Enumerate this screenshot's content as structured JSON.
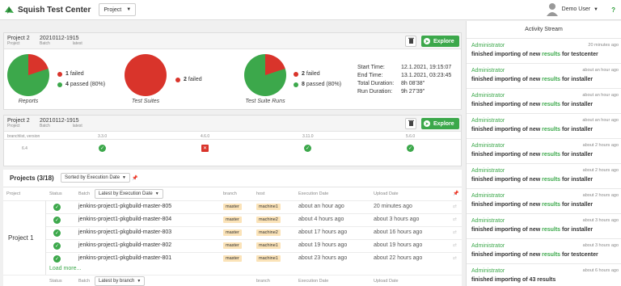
{
  "app": {
    "title": "Squish Test Center",
    "help": "?"
  },
  "header": {
    "project_select": "Project",
    "user_name": "Demo User"
  },
  "colors": {
    "pass": "#3ca84b",
    "fail": "#d9342b",
    "accent": "#3ca84b",
    "tag": "#fbe3b8"
  },
  "summary": {
    "project": "Project 2",
    "project_label": "Project",
    "batch": "20210112-1915",
    "batch_label": "Batch",
    "latest_label": "latest",
    "explore": "Explore",
    "charts": [
      {
        "caption": "Reports",
        "failed": "1",
        "failed_label": "failed",
        "passed": "4",
        "passed_label": "passed (80%)",
        "fail_fraction": 0.2
      },
      {
        "caption": "Test Suites",
        "failed": "2",
        "failed_label": "failed",
        "fail_fraction": 1.0
      },
      {
        "caption": "Test Suite Runs",
        "failed": "2",
        "failed_label": "failed",
        "passed": "8",
        "passed_label": "passed (80%)",
        "fail_fraction": 0.2
      }
    ],
    "times": {
      "start_label": "Start Time:",
      "start": "12.1.2021, 19:15:07",
      "end_label": "End Time:",
      "end": "13.1.2021, 03:23:45",
      "total_label": "Total Duration:",
      "total": "8h 08'38\"",
      "run_label": "Run Duration:",
      "run": "9h 27'39\""
    }
  },
  "matrix": {
    "project": "Project 2",
    "project_label": "Project",
    "batch": "20210112-1915",
    "batch_label": "Batch",
    "latest_label": "latest",
    "explore": "Explore",
    "corner": "branchlist, version",
    "columns": [
      "3.3.0",
      "4.6.0",
      "3.11.0",
      "5.6.0"
    ],
    "row_label": "6.4",
    "statuses": [
      "pass",
      "fail",
      "pass",
      "pass"
    ]
  },
  "projects": {
    "title": "Projects (3/18)",
    "sort": "Sorted by Execution Date",
    "headers": {
      "project": "Project",
      "status": "Status",
      "batch": "Batch",
      "batch_sort": "Latest by Execution Date",
      "branch": "branch",
      "host": "host",
      "exec": "Execution Date",
      "upload": "Upload Date"
    },
    "group": "Project 1",
    "rows": [
      {
        "batch": "jenkins-project1-pkgbuild-master-805",
        "branch": "master",
        "host": "machine1",
        "exec": "about an hour ago",
        "upload": "20 minutes ago"
      },
      {
        "batch": "jenkins-project1-pkgbuild-master-804",
        "branch": "master",
        "host": "machine2",
        "exec": "about 4 hours ago",
        "upload": "about 3 hours ago"
      },
      {
        "batch": "jenkins-project1-pkgbuild-master-803",
        "branch": "master",
        "host": "machine2",
        "exec": "about 17 hours ago",
        "upload": "about 16 hours ago"
      },
      {
        "batch": "jenkins-project1-pkgbuild-master-802",
        "branch": "master",
        "host": "machine1",
        "exec": "about 19 hours ago",
        "upload": "about 19 hours ago"
      },
      {
        "batch": "jenkins-project1-pkgbuild-master-801",
        "branch": "master",
        "host": "machine1",
        "exec": "about 23 hours ago",
        "upload": "about 22 hours ago"
      }
    ],
    "load_more": "Load more...",
    "footer": {
      "status": "Status",
      "batch": "Batch",
      "batch_sort": "Latest by branch",
      "branch": "branch",
      "exec": "Execution Date",
      "upload": "Upload Date"
    }
  },
  "activity": {
    "title": "Activity Stream",
    "items": [
      {
        "user": "Administrator",
        "time": "20 minutes ago",
        "pre": "finished importing of new",
        "link": "results",
        "post": "for testcenter"
      },
      {
        "user": "Administrator",
        "time": "about an hour ago",
        "pre": "finished importing of new",
        "link": "results",
        "post": "for installer"
      },
      {
        "user": "Administrator",
        "time": "about an hour ago",
        "pre": "finished importing of new",
        "link": "results",
        "post": "for installer"
      },
      {
        "user": "Administrator",
        "time": "about an hour ago",
        "pre": "finished importing of new",
        "link": "results",
        "post": "for installer"
      },
      {
        "user": "Administrator",
        "time": "about 2 hours ago",
        "pre": "finished importing of new",
        "link": "results",
        "post": "for installer"
      },
      {
        "user": "Administrator",
        "time": "about 2 hours ago",
        "pre": "finished importing of new",
        "link": "results",
        "post": "for installer"
      },
      {
        "user": "Administrator",
        "time": "about 2 hours ago",
        "pre": "finished importing of new",
        "link": "results",
        "post": "for installer"
      },
      {
        "user": "Administrator",
        "time": "about 3 hours ago",
        "pre": "finished importing of new",
        "link": "results",
        "post": "for installer"
      },
      {
        "user": "Administrator",
        "time": "about 3 hours ago",
        "pre": "finished importing of new",
        "link": "results",
        "post": "for testcenter"
      },
      {
        "user": "Administrator",
        "time": "about 6 hours ago",
        "pre": "finished importing of 43 results",
        "link": "",
        "post": ""
      }
    ]
  }
}
